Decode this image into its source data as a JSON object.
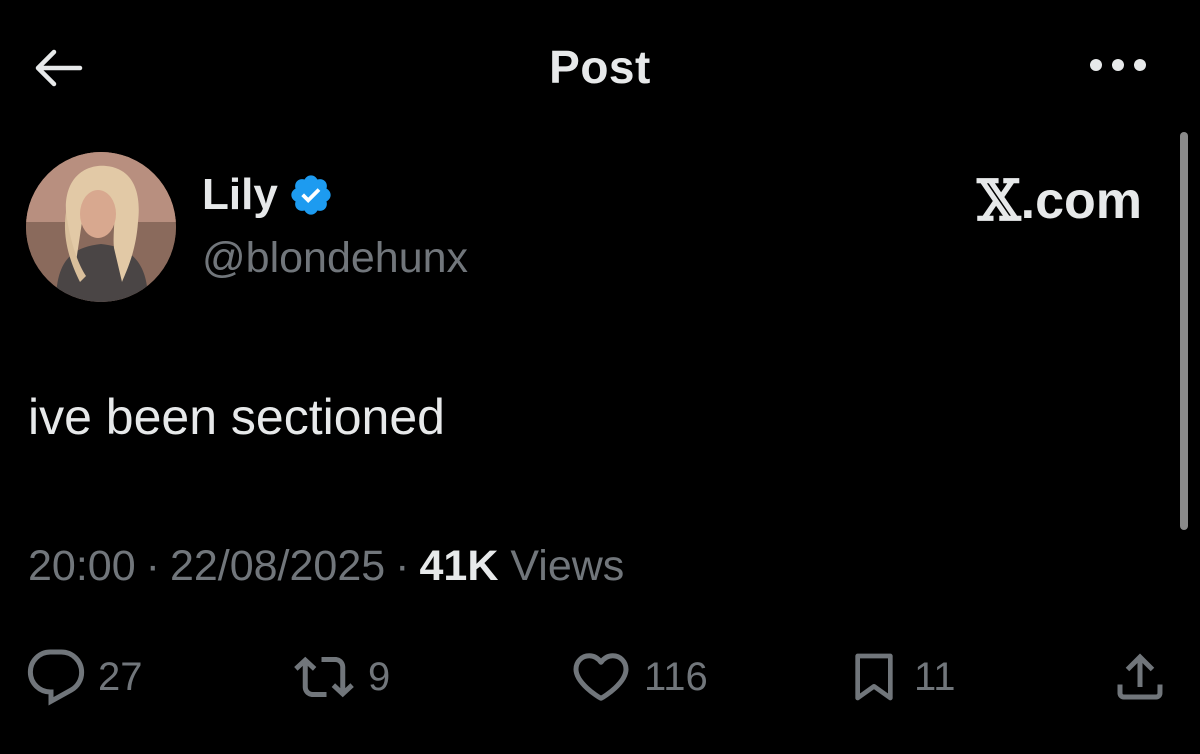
{
  "header": {
    "title": "Post"
  },
  "post": {
    "author": {
      "name": "Lily",
      "handle": "@blondehunx",
      "verified": true
    },
    "watermark_suffix": ".com",
    "text": "ive been sectioned",
    "meta": {
      "time": "20:00",
      "date": "22/08/2025",
      "views_count": "41K",
      "views_label": "Views",
      "separator": "·"
    },
    "actions": {
      "replies": "27",
      "reposts": "9",
      "likes": "116",
      "bookmarks": "11"
    }
  },
  "colors": {
    "background": "#000000",
    "primary_text": "#e7e9ea",
    "secondary_text": "#71767b",
    "verified_badge": "#1d9bf0"
  },
  "icons": {
    "back": "arrow-left-icon",
    "more": "more-horizontal-icon",
    "verified": "verified-badge-icon",
    "reply": "reply-icon",
    "repost": "repost-icon",
    "like": "heart-icon",
    "bookmark": "bookmark-icon",
    "share": "share-icon"
  }
}
